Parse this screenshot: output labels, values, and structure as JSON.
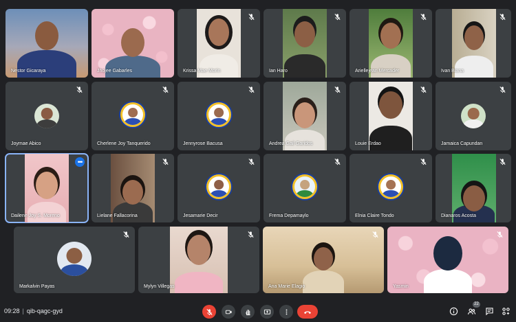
{
  "participants": [
    {
      "name": "Nestor Gicaraya",
      "muted": false
    },
    {
      "name": "Jhojee Gabarles",
      "muted": false
    },
    {
      "name": "Krissa Mae Morin",
      "muted": true
    },
    {
      "name": "Ian Haro",
      "muted": true
    },
    {
      "name": "Ariellejean Mercader",
      "muted": true
    },
    {
      "name": "Ivan Biana",
      "muted": true
    },
    {
      "name": "Joymae Abico",
      "muted": true
    },
    {
      "name": "Cherlene Joy Tanquerido",
      "muted": true
    },
    {
      "name": "Jennyrose Bacusa",
      "muted": true
    },
    {
      "name": "Andrea Gail Garidos",
      "muted": true
    },
    {
      "name": "Louie Erdao",
      "muted": true
    },
    {
      "name": "Jamaica Capundan",
      "muted": true
    },
    {
      "name": "Dailene Joy S. Moreno",
      "muted": false,
      "more_menu": "•••"
    },
    {
      "name": "Lielane Fallacorina",
      "muted": true
    },
    {
      "name": "Jesamarie Decir",
      "muted": true
    },
    {
      "name": "Frema Depamaylo",
      "muted": true
    },
    {
      "name": "Elnia Claire Tondo",
      "muted": true
    },
    {
      "name": "Dianaros Acosta",
      "muted": true
    },
    {
      "name": "Markalvin Payas",
      "muted": true
    },
    {
      "name": "Mylyn Villegas",
      "muted": true
    },
    {
      "name": "Ana Marie Elagio",
      "muted": true
    },
    {
      "name": "Yasmin",
      "muted": true
    }
  ],
  "meeting": {
    "time": "09:28",
    "code": "qib-qagc-gyd"
  },
  "controls": {
    "mic": "mic-off-icon",
    "camera": "camera-icon",
    "hand": "raise-hand-icon",
    "present": "present-screen-icon",
    "more": "more-options-icon",
    "end": "end-call-icon"
  },
  "right_panel": {
    "people_count": "22"
  },
  "colors": {
    "background": "#202124",
    "tile": "#3c4043",
    "danger": "#ea4335",
    "selected_outline": "#8ab4f8"
  }
}
